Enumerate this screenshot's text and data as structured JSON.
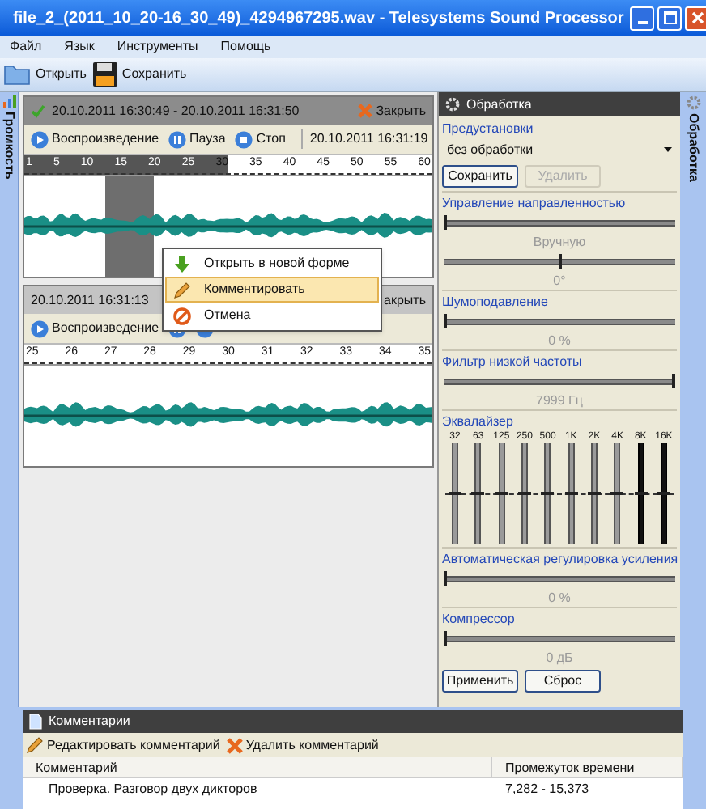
{
  "window": {
    "title": "file_2_(2011_10_20-16_30_49)_4294967295.wav - Telesystems Sound Processor"
  },
  "menu": [
    "Файл",
    "Язык",
    "Инструменты",
    "Помощь"
  ],
  "toolbar": [
    {
      "label": "Открыть",
      "kind": "open"
    },
    {
      "label": "Сохранить",
      "kind": "save"
    }
  ],
  "left_tab": {
    "label": "Громкость"
  },
  "tracks": [
    {
      "selected": true,
      "title": "20.10.2011 16:30:49 - 20.10.2011 16:31:50",
      "close": "Закрыть",
      "controls": [
        {
          "kind": "play",
          "label": "Воспроизведение"
        },
        {
          "kind": "pause",
          "label": "Пауза"
        },
        {
          "kind": "stop",
          "label": "Стоп"
        }
      ],
      "position": "20.10.2011 16:31:19",
      "progress": {
        "level": 0.5
      },
      "ruler": [
        "1",
        "5",
        "10",
        "15",
        "20",
        "25",
        "30",
        "35",
        "40",
        "45",
        "50",
        "55",
        "60"
      ],
      "has_selection": true
    },
    {
      "selected": false,
      "title": "20.10.2011 16:31:13",
      "close": "акрыть",
      "controls": [
        {
          "kind": "play",
          "label": "Воспроизведение"
        },
        {
          "kind": "pause"
        },
        {
          "kind": "stop"
        }
      ],
      "ruler": [
        "25",
        "26",
        "27",
        "28",
        "29",
        "30",
        "31",
        "32",
        "33",
        "34",
        "35"
      ],
      "has_selection": false
    }
  ],
  "context_menu": [
    {
      "label": "Открыть в новой форме",
      "kind": "open",
      "selected": false
    },
    {
      "label": "Комментировать",
      "kind": "comment",
      "selected": true
    },
    {
      "label": "Отмена",
      "kind": "cancel",
      "selected": false
    }
  ],
  "processing": {
    "title": "Обработка",
    "presets": {
      "label": "Предустановки",
      "value": "без обработки",
      "buttons": [
        {
          "label": "Сохранить",
          "disabled": false
        },
        {
          "label": "Удалить",
          "disabled": true
        }
      ]
    },
    "sections": [
      {
        "label": "Управление направленностью",
        "controls": [
          {
            "kind": "slider",
            "level": 0
          },
          {
            "kind": "caption",
            "text": "Вручную"
          },
          {
            "kind": "slider",
            "level": 0.5
          },
          {
            "kind": "caption",
            "text": "0°"
          }
        ]
      },
      {
        "label": "Шумоподавление",
        "controls": [
          {
            "kind": "slider",
            "level": 0
          },
          {
            "kind": "caption",
            "text": "0 %"
          }
        ]
      },
      {
        "label": "Фильтр низкой частоты",
        "controls": [
          {
            "kind": "slider",
            "level": 1
          },
          {
            "kind": "caption",
            "text": "7999 Гц"
          }
        ]
      },
      {
        "label": "Эквалайзер",
        "controls": [
          {
            "kind": "equalizer",
            "bands": [
              {
                "label": "32",
                "level": 0.5,
                "active": false
              },
              {
                "label": "63",
                "level": 0.5,
                "active": false
              },
              {
                "label": "125",
                "level": 0.5,
                "active": false
              },
              {
                "label": "250",
                "level": 0.5,
                "active": false
              },
              {
                "label": "500",
                "level": 0.5,
                "active": false
              },
              {
                "label": "1K",
                "level": 0.5,
                "active": false
              },
              {
                "label": "2K",
                "level": 0.5,
                "active": false
              },
              {
                "label": "4K",
                "level": 0.5,
                "active": false
              },
              {
                "label": "8K",
                "level": 0.5,
                "active": true
              },
              {
                "label": "16K",
                "level": 0.5,
                "active": true
              }
            ]
          }
        ]
      },
      {
        "label": "Автоматическая регулировка усиления",
        "controls": [
          {
            "kind": "slider",
            "level": 0
          },
          {
            "kind": "caption",
            "text": "0 %"
          }
        ]
      },
      {
        "label": "Компрессор",
        "controls": [
          {
            "kind": "slider",
            "level": 0
          },
          {
            "kind": "caption",
            "text": "0 дБ"
          }
        ]
      }
    ],
    "actions": [
      "Применить",
      "Сброс"
    ]
  },
  "right_tab": {
    "label": "Обработка"
  },
  "comments": {
    "title": "Комментарии",
    "tools": [
      {
        "label": "Редактировать комментарий",
        "kind": "edit"
      },
      {
        "label": "Удалить комментарий",
        "kind": "delete"
      }
    ],
    "columns": [
      "Комментарий",
      "Промежуток времени"
    ],
    "rows": [
      [
        "Проверка. Разговор двух дикторов",
        "7,282 - 15,373"
      ]
    ]
  }
}
